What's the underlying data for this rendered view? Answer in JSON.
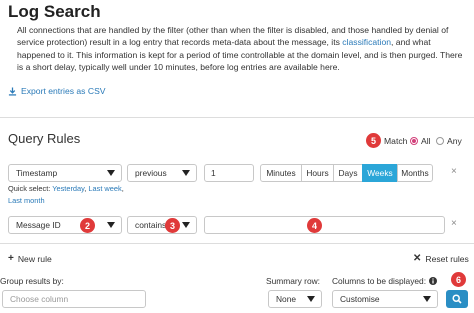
{
  "page": {
    "title": "Log Search",
    "intro_1": "All connections that are handled by the filter (other than when the filter is disabled, and those handled by denial of service protection) result in a log entry that records meta-data about the message, its ",
    "intro_link": "classification",
    "intro_2": ", and what happened to it. This information is kept for a period of time controllable at the domain level, and is then purged. There is a short delay, typically well under 10 minutes, before log entries are available here.",
    "export_label": "Export entries as CSV"
  },
  "query": {
    "title": "Query Rules",
    "match_label": "Match",
    "match_options": [
      "All",
      "Any"
    ],
    "match_selected": "All",
    "rule1": {
      "field": "Timestamp",
      "operator": "previous",
      "value": "1",
      "units": [
        "Minutes",
        "Hours",
        "Days",
        "Weeks",
        "Months"
      ],
      "active_unit": "Weeks",
      "remove": "×"
    },
    "quick_select_label": "Quick select:",
    "quick_links": [
      "Yesterday",
      "Last week",
      "Last month"
    ],
    "rule2": {
      "field": "Message ID",
      "operator": "contains",
      "value": "",
      "remove": "×"
    },
    "new_rule_label": "New rule",
    "reset_label": "Reset rules"
  },
  "footer": {
    "group_label": "Group results by:",
    "group_placeholder": "Choose column",
    "summary_label": "Summary row:",
    "summary_value": "None",
    "columns_label": "Columns to be displayed:",
    "columns_value": "Customise"
  },
  "badges": [
    "2",
    "3",
    "4",
    "5",
    "6"
  ],
  "colors": {
    "accent": "#2ba6d8",
    "link": "#2a7ab8",
    "badge": "#e03a3a",
    "radio": "#d2407a",
    "search_button": "#2a8ec4"
  }
}
